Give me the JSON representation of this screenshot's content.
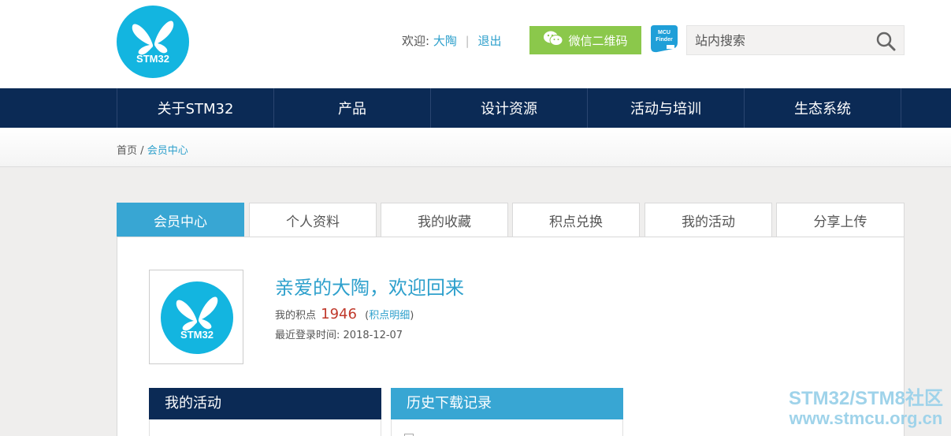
{
  "header": {
    "logo_text": "STM32",
    "welcome_label": "欢迎:",
    "username": "大陶",
    "logout_label": "退出",
    "wechat_label": "微信二维码",
    "mcu_finder_lines": [
      "MCU",
      "Finder"
    ],
    "search_placeholder": "站内搜索"
  },
  "nav": {
    "items": [
      "关于STM32",
      "产品",
      "设计资源",
      "活动与培训",
      "生态系统"
    ]
  },
  "breadcrumb": {
    "home": "首页",
    "separator": "/",
    "current": "会员中心"
  },
  "tabs": [
    "会员中心",
    "个人资料",
    "我的收藏",
    "积点兑换",
    "我的活动",
    "分享上传"
  ],
  "profile": {
    "avatar_text": "STM32",
    "greeting": "亲爱的大陶，欢迎回来",
    "points_label": "我的积点",
    "points_value": "1946",
    "points_link": "积点明细",
    "last_login_label": "最近登录时间:",
    "last_login_date": "2018-12-07"
  },
  "boxes": {
    "activity_title": "我的活动",
    "history_title": "历史下载记录"
  },
  "watermark": {
    "line1": "STM32/STM8社区",
    "line2": "www.stmcu.org.cn"
  },
  "colors": {
    "brand_blue": "#13b5e0",
    "nav_navy": "#0b2a55",
    "tab_active": "#38a6d3",
    "link": "#2ea0cc",
    "wechat_green": "#8bc84b",
    "points_red": "#c0392b"
  }
}
